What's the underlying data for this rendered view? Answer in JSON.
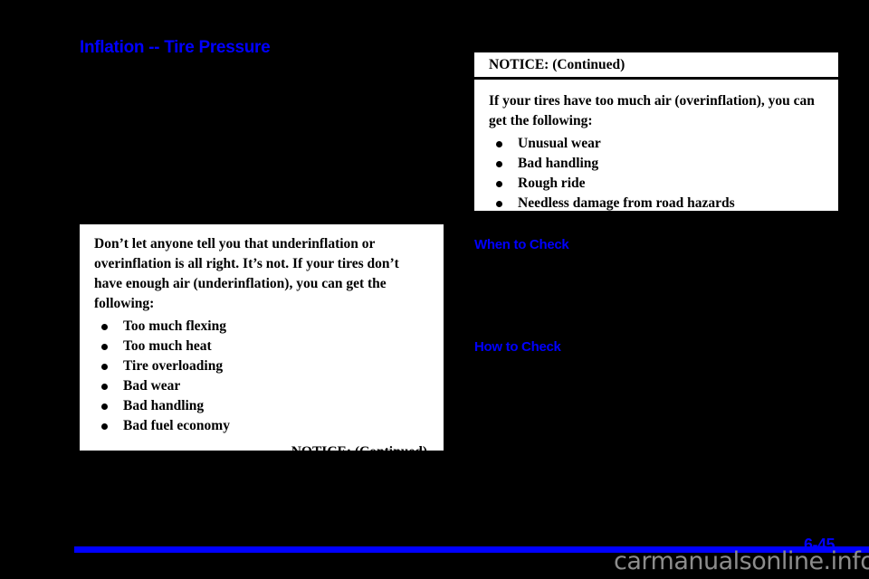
{
  "page": {
    "background_color": "#000000",
    "accent_color": "#0000ff",
    "paper_color": "#ffffff"
  },
  "section_title": "Inflation -- Tire Pressure",
  "left_notice": {
    "paragraph": "Don’t let anyone tell you that underinflation or overinflation is all right. It’s not. If your tires don’t have enough air (underinflation), you can get the following:",
    "bullets": [
      "Too much flexing",
      "Too much heat",
      "Tire overloading",
      "Bad wear",
      "Bad handling",
      "Bad fuel economy"
    ],
    "continued_label": "NOTICE: (Continued)"
  },
  "right_notice": {
    "header": "NOTICE: (Continued)",
    "paragraph": "If your tires have too much air (overinflation), you can get the following:",
    "bullets": [
      "Unusual wear",
      "Bad handling",
      "Rough ride",
      "Needless damage from road hazards"
    ]
  },
  "subheads": {
    "when_to_check": "When to Check",
    "how_to_check": "How to Check"
  },
  "footer": {
    "page_number": "6-45",
    "watermark": "carmanualsonline.info"
  }
}
